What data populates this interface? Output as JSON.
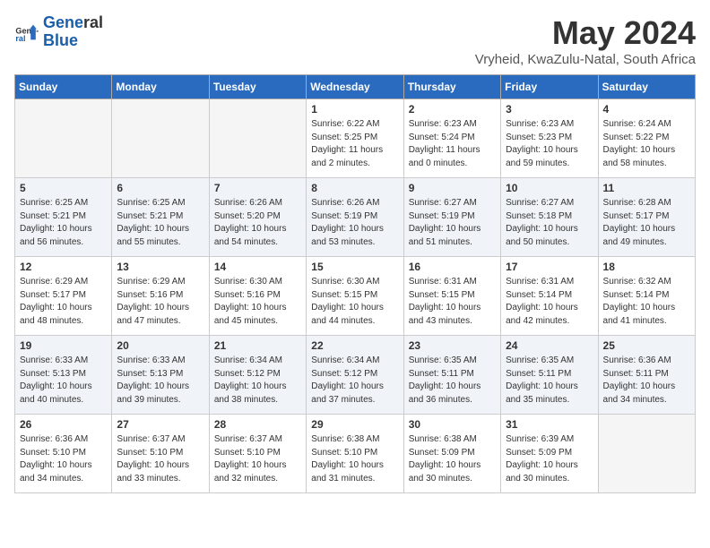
{
  "logo": {
    "line1": "General",
    "line2": "Blue"
  },
  "title": "May 2024",
  "location": "Vryheid, KwaZulu-Natal, South Africa",
  "weekdays": [
    "Sunday",
    "Monday",
    "Tuesday",
    "Wednesday",
    "Thursday",
    "Friday",
    "Saturday"
  ],
  "weeks": [
    [
      {
        "day": "",
        "info": ""
      },
      {
        "day": "",
        "info": ""
      },
      {
        "day": "",
        "info": ""
      },
      {
        "day": "1",
        "info": "Sunrise: 6:22 AM\nSunset: 5:25 PM\nDaylight: 11 hours\nand 2 minutes."
      },
      {
        "day": "2",
        "info": "Sunrise: 6:23 AM\nSunset: 5:24 PM\nDaylight: 11 hours\nand 0 minutes."
      },
      {
        "day": "3",
        "info": "Sunrise: 6:23 AM\nSunset: 5:23 PM\nDaylight: 10 hours\nand 59 minutes."
      },
      {
        "day": "4",
        "info": "Sunrise: 6:24 AM\nSunset: 5:22 PM\nDaylight: 10 hours\nand 58 minutes."
      }
    ],
    [
      {
        "day": "5",
        "info": "Sunrise: 6:25 AM\nSunset: 5:21 PM\nDaylight: 10 hours\nand 56 minutes."
      },
      {
        "day": "6",
        "info": "Sunrise: 6:25 AM\nSunset: 5:21 PM\nDaylight: 10 hours\nand 55 minutes."
      },
      {
        "day": "7",
        "info": "Sunrise: 6:26 AM\nSunset: 5:20 PM\nDaylight: 10 hours\nand 54 minutes."
      },
      {
        "day": "8",
        "info": "Sunrise: 6:26 AM\nSunset: 5:19 PM\nDaylight: 10 hours\nand 53 minutes."
      },
      {
        "day": "9",
        "info": "Sunrise: 6:27 AM\nSunset: 5:19 PM\nDaylight: 10 hours\nand 51 minutes."
      },
      {
        "day": "10",
        "info": "Sunrise: 6:27 AM\nSunset: 5:18 PM\nDaylight: 10 hours\nand 50 minutes."
      },
      {
        "day": "11",
        "info": "Sunrise: 6:28 AM\nSunset: 5:17 PM\nDaylight: 10 hours\nand 49 minutes."
      }
    ],
    [
      {
        "day": "12",
        "info": "Sunrise: 6:29 AM\nSunset: 5:17 PM\nDaylight: 10 hours\nand 48 minutes."
      },
      {
        "day": "13",
        "info": "Sunrise: 6:29 AM\nSunset: 5:16 PM\nDaylight: 10 hours\nand 47 minutes."
      },
      {
        "day": "14",
        "info": "Sunrise: 6:30 AM\nSunset: 5:16 PM\nDaylight: 10 hours\nand 45 minutes."
      },
      {
        "day": "15",
        "info": "Sunrise: 6:30 AM\nSunset: 5:15 PM\nDaylight: 10 hours\nand 44 minutes."
      },
      {
        "day": "16",
        "info": "Sunrise: 6:31 AM\nSunset: 5:15 PM\nDaylight: 10 hours\nand 43 minutes."
      },
      {
        "day": "17",
        "info": "Sunrise: 6:31 AM\nSunset: 5:14 PM\nDaylight: 10 hours\nand 42 minutes."
      },
      {
        "day": "18",
        "info": "Sunrise: 6:32 AM\nSunset: 5:14 PM\nDaylight: 10 hours\nand 41 minutes."
      }
    ],
    [
      {
        "day": "19",
        "info": "Sunrise: 6:33 AM\nSunset: 5:13 PM\nDaylight: 10 hours\nand 40 minutes."
      },
      {
        "day": "20",
        "info": "Sunrise: 6:33 AM\nSunset: 5:13 PM\nDaylight: 10 hours\nand 39 minutes."
      },
      {
        "day": "21",
        "info": "Sunrise: 6:34 AM\nSunset: 5:12 PM\nDaylight: 10 hours\nand 38 minutes."
      },
      {
        "day": "22",
        "info": "Sunrise: 6:34 AM\nSunset: 5:12 PM\nDaylight: 10 hours\nand 37 minutes."
      },
      {
        "day": "23",
        "info": "Sunrise: 6:35 AM\nSunset: 5:11 PM\nDaylight: 10 hours\nand 36 minutes."
      },
      {
        "day": "24",
        "info": "Sunrise: 6:35 AM\nSunset: 5:11 PM\nDaylight: 10 hours\nand 35 minutes."
      },
      {
        "day": "25",
        "info": "Sunrise: 6:36 AM\nSunset: 5:11 PM\nDaylight: 10 hours\nand 34 minutes."
      }
    ],
    [
      {
        "day": "26",
        "info": "Sunrise: 6:36 AM\nSunset: 5:10 PM\nDaylight: 10 hours\nand 34 minutes."
      },
      {
        "day": "27",
        "info": "Sunrise: 6:37 AM\nSunset: 5:10 PM\nDaylight: 10 hours\nand 33 minutes."
      },
      {
        "day": "28",
        "info": "Sunrise: 6:37 AM\nSunset: 5:10 PM\nDaylight: 10 hours\nand 32 minutes."
      },
      {
        "day": "29",
        "info": "Sunrise: 6:38 AM\nSunset: 5:10 PM\nDaylight: 10 hours\nand 31 minutes."
      },
      {
        "day": "30",
        "info": "Sunrise: 6:38 AM\nSunset: 5:09 PM\nDaylight: 10 hours\nand 30 minutes."
      },
      {
        "day": "31",
        "info": "Sunrise: 6:39 AM\nSunset: 5:09 PM\nDaylight: 10 hours\nand 30 minutes."
      },
      {
        "day": "",
        "info": ""
      }
    ]
  ]
}
